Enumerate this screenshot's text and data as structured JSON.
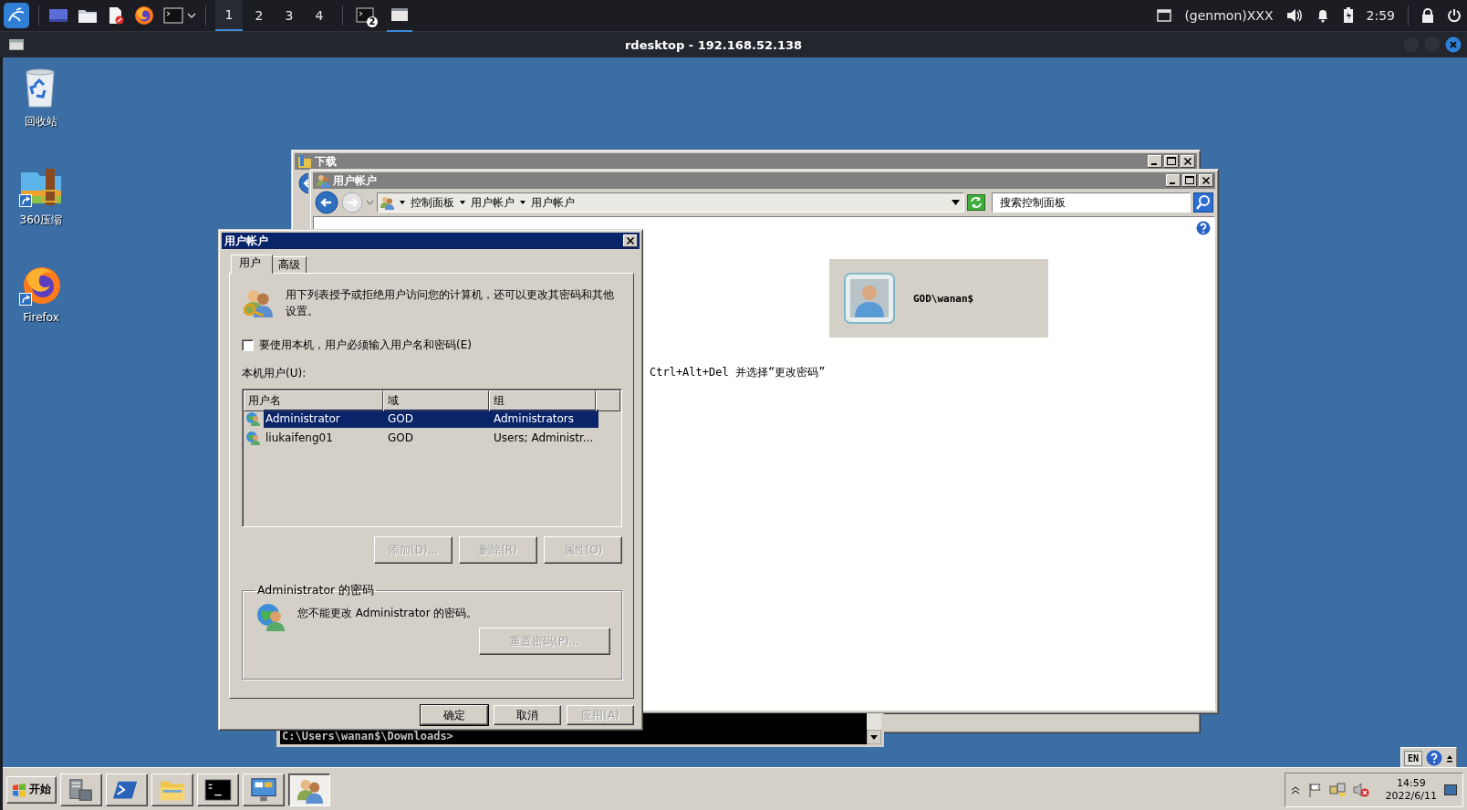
{
  "top_panel": {
    "workspaces": [
      {
        "label": "1",
        "selected": true
      },
      {
        "label": "2",
        "selected": false
      },
      {
        "label": "3",
        "selected": false
      },
      {
        "label": "4",
        "selected": false
      }
    ],
    "terminal_badge": "2",
    "genmon": "(genmon)XXX",
    "clock": "2:59"
  },
  "rdesktop": {
    "title": "rdesktop - 192.168.52.138"
  },
  "desktop_icons": [
    {
      "label": "回收站",
      "kind": "recycle"
    },
    {
      "label": "360压缩",
      "kind": "archive"
    },
    {
      "label": "Firefox",
      "kind": "firefox"
    }
  ],
  "downloads_window": {
    "title": "下载"
  },
  "control_panel": {
    "title": "用户帐户",
    "breadcrumb": [
      "控制面板",
      "用户帐户",
      "用户帐户"
    ],
    "search": {
      "placeholder": "搜索控制面板"
    },
    "user_tile": "GOD\\wanan$",
    "hint": "Ctrl+Alt+Del 并选择“更改密码”"
  },
  "cmd": {
    "prompt": "C:\\Users\\wanan$\\Downloads>"
  },
  "dialog": {
    "title": "用户帐户",
    "tabs": [
      {
        "label": "用户",
        "selected": true
      },
      {
        "label": "高级",
        "selected": false
      }
    ],
    "intro": "用下列表授予或拒绝用户访问您的计算机，还可以更改其密码和其他设置。",
    "require_login": {
      "label": "要使用本机，用户必须输入用户名和密码(E)",
      "checked": false
    },
    "users_label": "本机用户(U):",
    "table": {
      "columns": [
        "用户名",
        "域",
        "组"
      ],
      "rows": [
        {
          "cells": [
            "Administrator",
            "GOD",
            "Administrators"
          ],
          "selected": true
        },
        {
          "cells": [
            "liukaifeng01",
            "GOD",
            "Users; Administr..."
          ],
          "selected": false
        }
      ]
    },
    "list_buttons": [
      {
        "label": "添加(D)...",
        "disabled": true
      },
      {
        "label": "删除(R)",
        "disabled": true
      },
      {
        "label": "属性(O)",
        "disabled": true
      }
    ],
    "password_group": {
      "title": "Administrator 的密码",
      "message": "您不能更改 Administrator 的密码。",
      "button": {
        "label": "重置密码(P)...",
        "disabled": true
      }
    },
    "buttons": [
      {
        "label": "确定",
        "disabled": false
      },
      {
        "label": "取消",
        "disabled": false
      },
      {
        "label": "应用(A)",
        "disabled": true
      }
    ]
  },
  "language_bar": {
    "label": "EN"
  },
  "taskbar": {
    "start": "开始",
    "apps": [
      {
        "kind": "server",
        "selected": false
      },
      {
        "kind": "powershell",
        "selected": false
      },
      {
        "kind": "explorer",
        "selected": false
      },
      {
        "kind": "cmd",
        "selected": false
      },
      {
        "kind": "control-panel",
        "selected": false
      },
      {
        "kind": "users",
        "selected": true
      }
    ],
    "clock": {
      "time": "14:59",
      "date": "2022/6/11"
    }
  }
}
